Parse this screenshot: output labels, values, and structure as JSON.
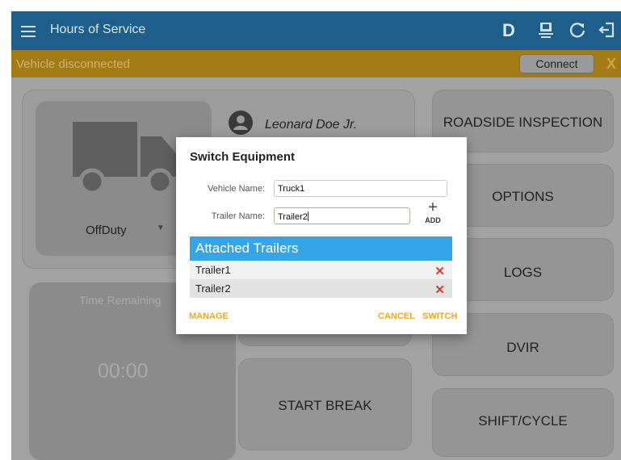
{
  "app_bar": {
    "title": "Hours of Service",
    "duty_indicator": "D",
    "icons": [
      "menu-icon",
      "device-sync-icon",
      "refresh-icon",
      "logout-icon"
    ]
  },
  "banner": {
    "message": "Vehicle disconnected",
    "connect_label": "Connect",
    "close_label": "X"
  },
  "driver": {
    "name": "Leonard Doe Jr.",
    "duty_status": "OffDuty"
  },
  "time_panel": {
    "label": "Time Remaining",
    "value": "00:00"
  },
  "center_buttons": {
    "start_break": "START BREAK"
  },
  "right_buttons": [
    "ROADSIDE INSPECTION",
    "OPTIONS",
    "LOGS",
    "DVIR",
    "SHIFT/CYCLE"
  ],
  "dialog": {
    "title": "Switch Equipment",
    "vehicle_label": "Vehicle Name:",
    "vehicle_value": "Truck1",
    "trailer_label": "Trailer Name:",
    "trailer_value": "Trailer2",
    "add_label": "ADD",
    "attached_header": "Attached Trailers",
    "trailers": [
      "Trailer1",
      "Trailer2"
    ],
    "remove_glyph": "✕",
    "manage_label": "MANAGE",
    "cancel_label": "CANCEL",
    "switch_label": "SWITCH"
  },
  "colors": {
    "app_bar": "#1d5f8a",
    "banner": "#a47b12",
    "accent": "#f1a821",
    "list_header": "#34a6e8",
    "remove": "#e03a2a"
  }
}
